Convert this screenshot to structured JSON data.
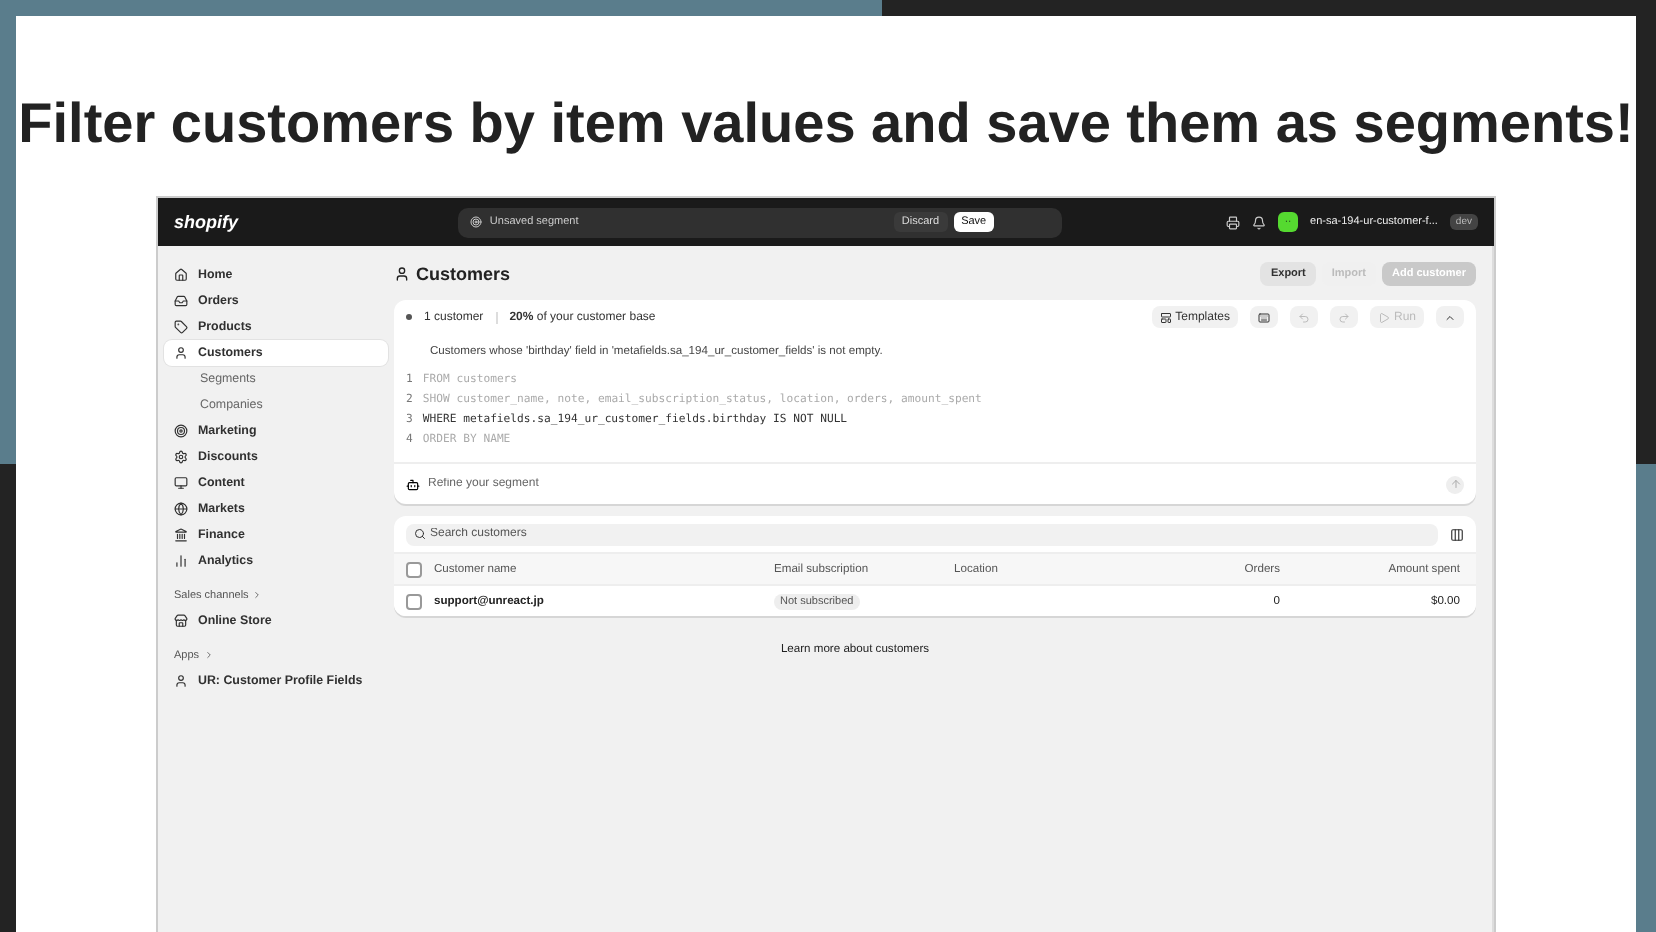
{
  "headline": "Filter customers by item values and save them as segments!",
  "topbar": {
    "logo": "shopify",
    "search": "Unsaved segment",
    "discard": "Discard",
    "save": "Save",
    "avatar": "··",
    "store": "en-sa-194-ur-customer-f...",
    "badge": "dev"
  },
  "sidebar": {
    "items": [
      {
        "kind": "main",
        "label": "Home",
        "selected": false
      },
      {
        "kind": "main",
        "label": "Orders",
        "selected": false
      },
      {
        "kind": "main",
        "label": "Products",
        "selected": false
      },
      {
        "kind": "main",
        "label": "Customers",
        "selected": true
      },
      {
        "kind": "sub",
        "label": "Segments",
        "selected": false
      },
      {
        "kind": "sub",
        "label": "Companies",
        "selected": false
      },
      {
        "kind": "main",
        "label": "Marketing",
        "selected": false
      },
      {
        "kind": "main",
        "label": "Discounts",
        "selected": false
      },
      {
        "kind": "main",
        "label": "Content",
        "selected": false
      },
      {
        "kind": "main",
        "label": "Markets",
        "selected": false
      },
      {
        "kind": "main",
        "label": "Finance",
        "selected": false
      },
      {
        "kind": "main",
        "label": "Analytics",
        "selected": false
      },
      {
        "kind": "section",
        "label": "Sales channels",
        "selected": false
      },
      {
        "kind": "main",
        "label": "Online Store",
        "selected": false
      },
      {
        "kind": "section",
        "label": "Apps",
        "selected": false
      },
      {
        "kind": "main",
        "label": "UR: Customer Profile Fields",
        "selected": false
      }
    ]
  },
  "page": {
    "title": "Customers",
    "actions": [
      {
        "label": "Export",
        "disabled": false,
        "primary": false
      },
      {
        "label": "Import",
        "disabled": true,
        "primary": false
      },
      {
        "label": "Add customer",
        "disabled": true,
        "primary": true
      }
    ]
  },
  "segment": {
    "count": "1 customer",
    "share": "20%",
    "share_rest": "of your customer base",
    "templates": "Templates",
    "run": {
      "label": "Run",
      "disabled": true
    },
    "description": "Customers whose 'birthday' field in 'metafields.sa_194_ur_customer_fields' is not empty.",
    "lines": [
      {
        "number": "1",
        "keyword": "FROM",
        "text": "customers",
        "emphasized": false
      },
      {
        "number": "2",
        "keyword": "SHOW",
        "text": "customer_name, note, email_subscription_status, location, orders, amount_spent",
        "emphasized": false
      },
      {
        "number": "3",
        "keyword": "WHERE",
        "text": "metafields.sa_194_ur_customer_fields.birthday IS NOT NULL",
        "emphasized": true
      },
      {
        "number": "4",
        "keyword": "ORDER BY",
        "text": "NAME",
        "emphasized": false
      }
    ],
    "refine_placeholder": "Refine your segment"
  },
  "table": {
    "search_placeholder": "Search customers",
    "all_checked": false,
    "columns": [
      "Customer name",
      "Email subscription",
      "Location",
      "Orders",
      "Amount spent"
    ],
    "rows": [
      {
        "checked": false,
        "name": "support@unreact.jp",
        "subscription": "Not subscribed",
        "location": "",
        "orders": "0",
        "amount": "$0.00"
      }
    ]
  },
  "footer_link": "Learn more about customers"
}
